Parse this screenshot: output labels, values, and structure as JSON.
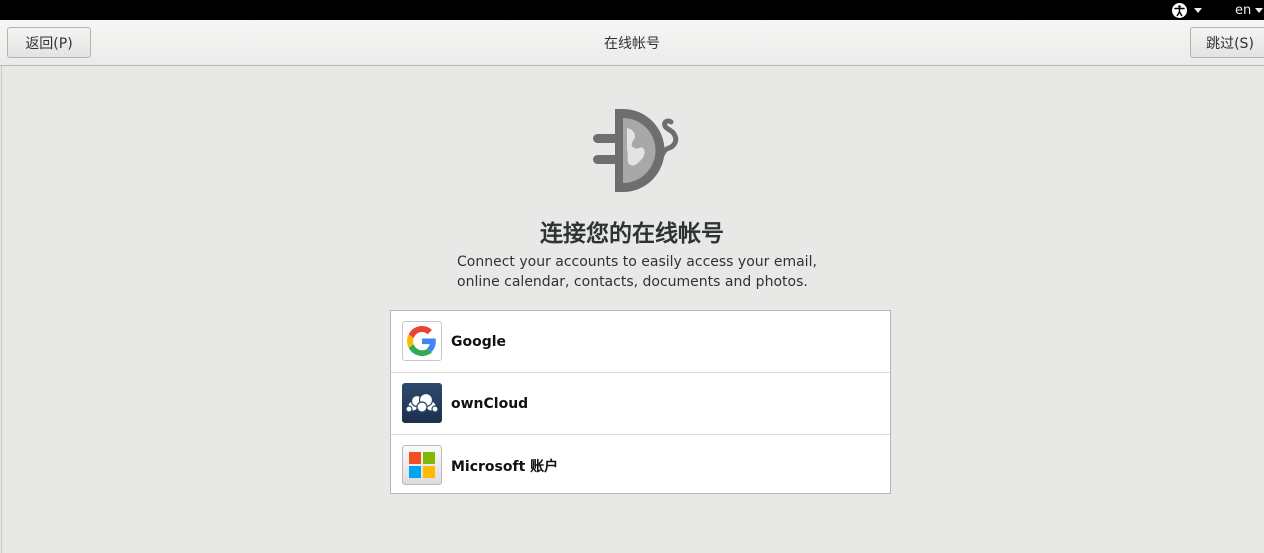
{
  "topbar": {
    "accessibility_icon": "accessibility-icon",
    "language": "en"
  },
  "header": {
    "back_label": "返回(P)",
    "title": "在线帐号",
    "skip_label": "跳过(S)"
  },
  "main": {
    "hero_icon": "online-accounts-icon",
    "heading": "连接您的在线帐号",
    "description_line1": "Connect your accounts to easily access your email,",
    "description_line2": "online calendar, contacts, documents and photos."
  },
  "providers": [
    {
      "label": "Google",
      "icon": "google-icon"
    },
    {
      "label": "ownCloud",
      "icon": "owncloud-icon"
    },
    {
      "label": "Microsoft 账户",
      "icon": "microsoft-icon"
    }
  ],
  "colors": {
    "background": "#e8e8e7",
    "top_bar": "#000000",
    "hero_icon_gray": "#6e6e6e"
  }
}
